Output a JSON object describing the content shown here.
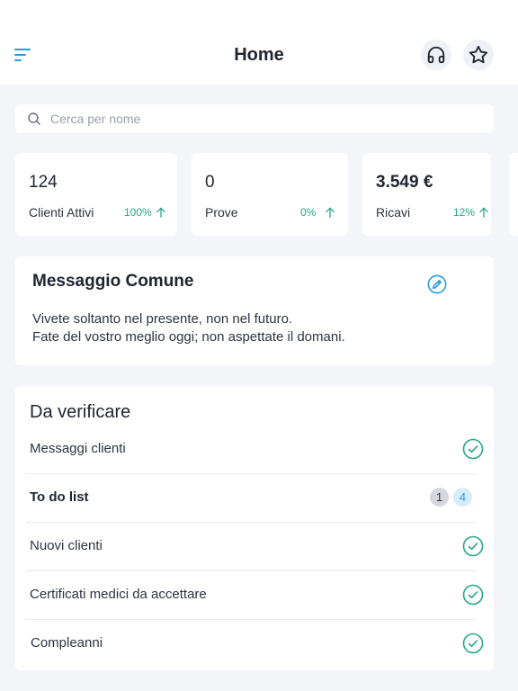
{
  "header": {
    "title": "Home"
  },
  "search": {
    "placeholder": "Cerca per nome"
  },
  "stats": [
    {
      "value": "124",
      "label": "Clienti Attivi",
      "change": "100%"
    },
    {
      "value": "0",
      "label": "Prove",
      "change": "0%"
    },
    {
      "value": "3.549 €",
      "label": "Ricavi",
      "change": "12%"
    }
  ],
  "message": {
    "title": "Messaggio Comune",
    "lines": [
      "Vivete soltanto nel presente, non nel futuro.",
      "Fate del vostro meglio oggi; non aspettate il domani."
    ]
  },
  "verify": {
    "title": "Da verificare",
    "items": [
      {
        "label": "Messaggi clienti"
      },
      {
        "label": "To do list",
        "badges": [
          "1",
          "4"
        ]
      },
      {
        "label": "Nuovi clienti"
      },
      {
        "label": "Certificati medici da accettare"
      },
      {
        "label": "Compleanni"
      }
    ]
  },
  "colors": {
    "accent": "#2a9fd8",
    "positive": "#26a688",
    "background": "#f3f5f9"
  },
  "icons": [
    "menu-icon",
    "headset-icon",
    "star-icon",
    "search-icon",
    "arrow-up-icon",
    "pencil-icon",
    "check-circle-icon"
  ]
}
